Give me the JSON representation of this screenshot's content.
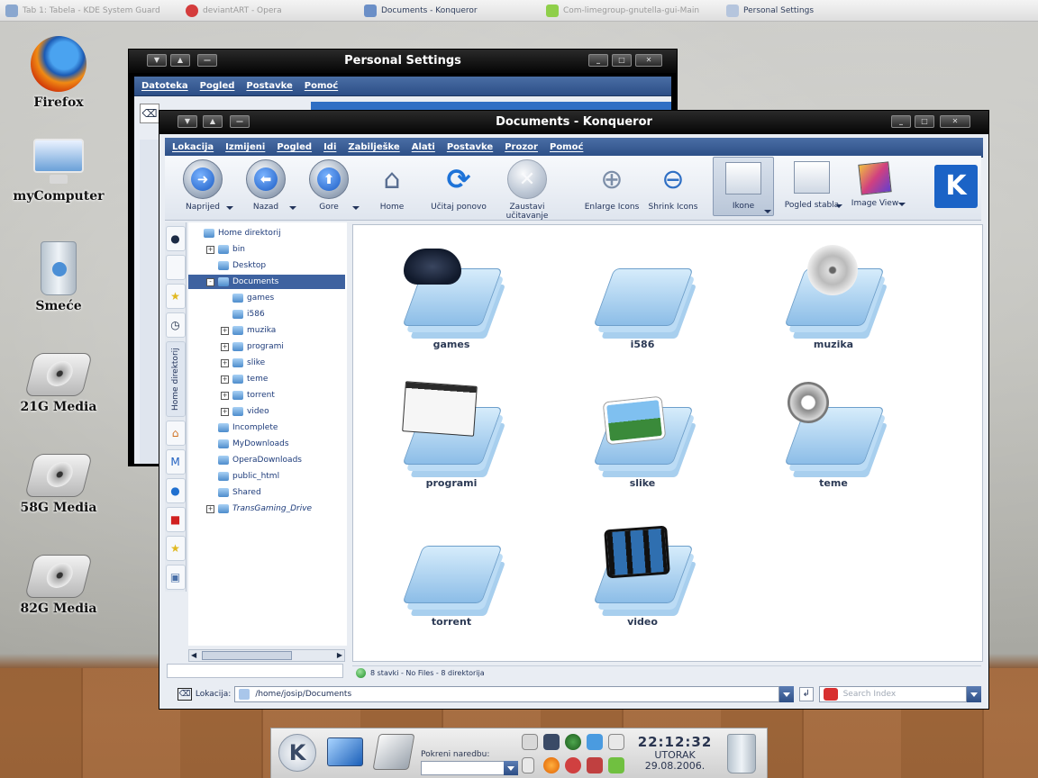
{
  "taskbar": {
    "items": [
      {
        "label": "Tab 1: Tabela - KDE System Guard",
        "active": false
      },
      {
        "label": "deviantART - Opera",
        "active": false
      },
      {
        "label": "Documents - Konqueror",
        "active": true
      },
      {
        "label": "Com-limegroup-gnutella-gui-Main",
        "active": false
      },
      {
        "label": "Personal Settings",
        "active": true
      }
    ]
  },
  "desktop": {
    "icons": [
      {
        "label": "Firefox"
      },
      {
        "label": "myComputer"
      },
      {
        "label": "Smeće"
      },
      {
        "label": "21G Media"
      },
      {
        "label": "58G Media"
      },
      {
        "label": "82G Media"
      }
    ]
  },
  "personal_settings": {
    "title": "Personal Settings",
    "menu": [
      "Datoteka",
      "Pogled",
      "Postavke",
      "Pomoć"
    ]
  },
  "konqueror": {
    "title": "Documents - Konqueror",
    "menu": [
      "Lokacija",
      "Izmijeni",
      "Pogled",
      "Idi",
      "Zabilješke",
      "Alati",
      "Postavke",
      "Prozor",
      "Pomoć"
    ],
    "toolbar": [
      {
        "label": "Naprijed",
        "icon": "forward-icon"
      },
      {
        "label": "Nazad",
        "icon": "back-icon"
      },
      {
        "label": "Gore",
        "icon": "up-icon"
      },
      {
        "label": "Home",
        "icon": "home-icon"
      },
      {
        "label": "Učitaj ponovo",
        "icon": "reload-icon"
      },
      {
        "label": "Zaustavi učitavanje",
        "icon": "stop-icon"
      },
      {
        "label": "Enlarge Icons",
        "icon": "zoom-in-icon"
      },
      {
        "label": "Shrink Icons",
        "icon": "zoom-out-icon"
      },
      {
        "label": "Ikone",
        "icon": "icon-view-icon"
      },
      {
        "label": "Pogled stabla",
        "icon": "tree-view-icon"
      },
      {
        "label": "Image View",
        "icon": "image-view-icon"
      }
    ],
    "side_tab_label": "Home direktorij",
    "tree": [
      {
        "label": "Home direktorij",
        "expander": ""
      },
      {
        "label": "bin",
        "expander": "+"
      },
      {
        "label": "Desktop",
        "expander": ""
      },
      {
        "label": "Documents",
        "expander": "-",
        "selected": true
      },
      {
        "label": "games",
        "expander": ""
      },
      {
        "label": "i586",
        "expander": ""
      },
      {
        "label": "muzika",
        "expander": "+"
      },
      {
        "label": "programi",
        "expander": "+"
      },
      {
        "label": "slike",
        "expander": "+"
      },
      {
        "label": "teme",
        "expander": "+"
      },
      {
        "label": "torrent",
        "expander": "+"
      },
      {
        "label": "video",
        "expander": "+"
      },
      {
        "label": "Incomplete",
        "expander": ""
      },
      {
        "label": "MyDownloads",
        "expander": ""
      },
      {
        "label": "OperaDownloads",
        "expander": ""
      },
      {
        "label": "public_html",
        "expander": ""
      },
      {
        "label": "Shared",
        "expander": ""
      },
      {
        "label": "TransGaming_Drive",
        "expander": "+"
      }
    ],
    "folders": [
      {
        "name": "games"
      },
      {
        "name": "i586"
      },
      {
        "name": "muzika"
      },
      {
        "name": "programi"
      },
      {
        "name": "slike"
      },
      {
        "name": "teme"
      },
      {
        "name": "torrent"
      },
      {
        "name": "video"
      }
    ],
    "status": "8 stavki - No Files - 8 direktorija",
    "location_label": "Lokacija:",
    "location_value": "/home/josip/Documents",
    "search_placeholder": "Search Index"
  },
  "panel": {
    "run_label": "Pokreni naredbu:",
    "time": "22:12:32",
    "day": "UTORAK",
    "date": "29.08.2006."
  },
  "colors": {
    "titlebar": "#050505",
    "menubar": "#2c4e86",
    "selection": "#3e62a0",
    "folder": "#8cbde7"
  }
}
